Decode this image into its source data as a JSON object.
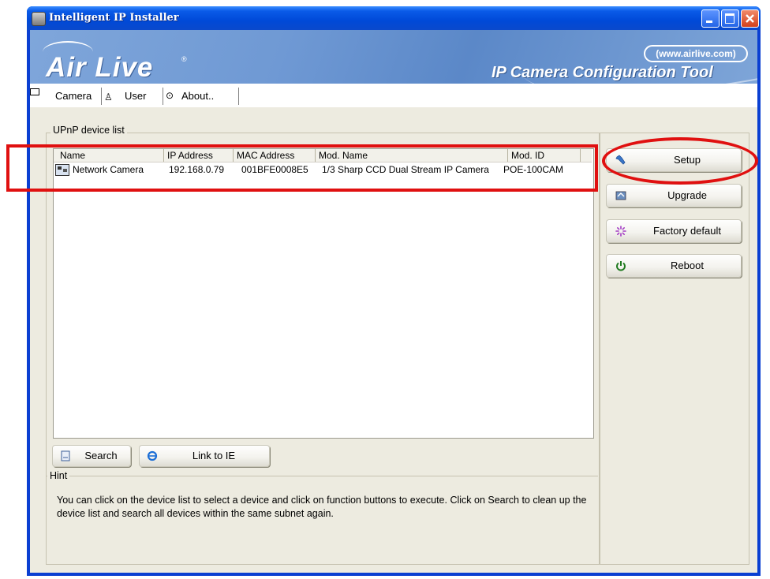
{
  "window": {
    "title": "Intelligent IP Installer"
  },
  "banner": {
    "logo": "Air Live",
    "url": "(www.airlive.com)",
    "title": "IP Camera Configuration Tool"
  },
  "tabs": [
    {
      "label": "Camera",
      "icon": "camera-icon",
      "selected": true
    },
    {
      "label": "User",
      "icon": "user-icon",
      "selected": false
    },
    {
      "label": "About..",
      "icon": "info-icon",
      "selected": false
    }
  ],
  "device_list": {
    "legend": "UPnP device list",
    "columns": [
      "Name",
      "IP Address",
      "MAC Address",
      "Mod. Name",
      "Mod. ID"
    ],
    "rows": [
      {
        "name": "Network Camera",
        "ip": "192.168.0.79",
        "mac": "001BFE0008E5",
        "mod_name": "1/3 Sharp CCD Dual Stream IP Camera",
        "mod_id": "POE-100CAM"
      }
    ]
  },
  "actions": {
    "setup": "Setup",
    "upgrade": "Upgrade",
    "factory_default": "Factory default",
    "reboot": "Reboot"
  },
  "bottom": {
    "search": "Search",
    "link_ie": "Link to IE"
  },
  "hint": {
    "legend": "Hint",
    "text": "You can click on the device list to select a device and click on function buttons to execute. Click on Search to clean up the device list and search all devices  within the same subnet again."
  },
  "colors": {
    "highlight": "#e01010",
    "titlebar": "#0A5BE8",
    "banner": "#6f99d4"
  }
}
